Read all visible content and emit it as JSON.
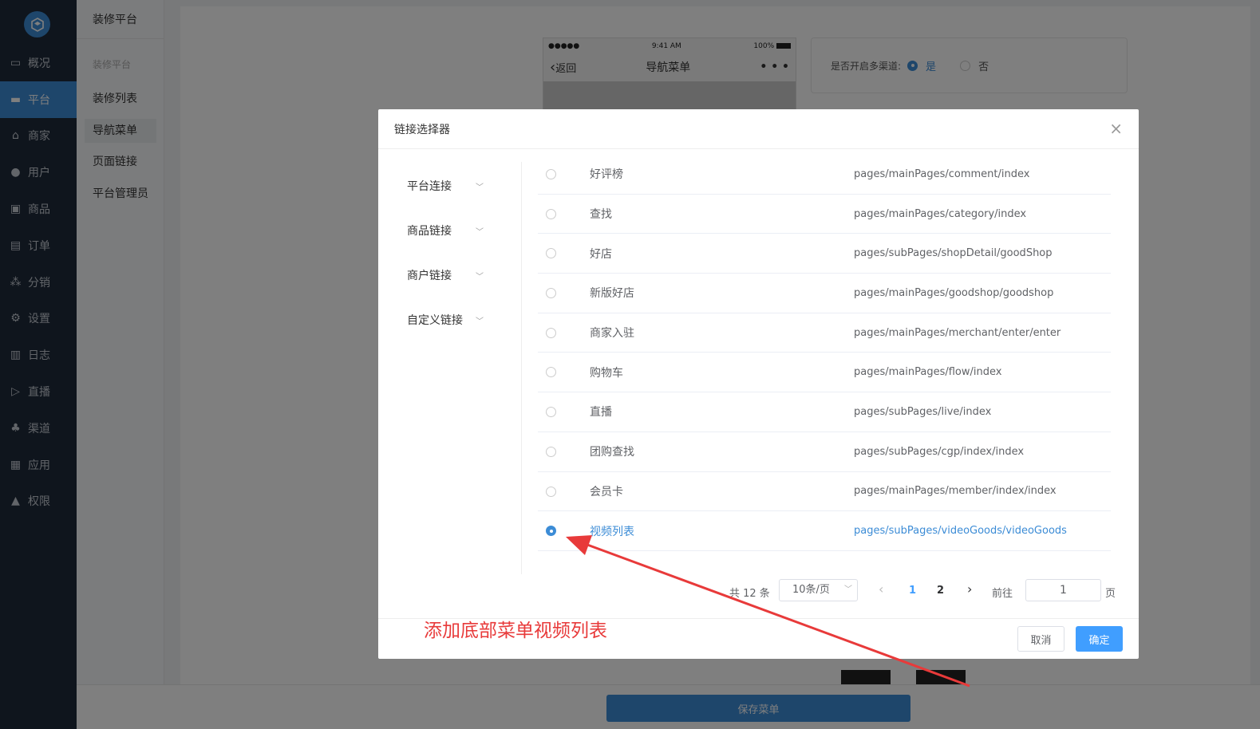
{
  "sidebar": {
    "items": [
      {
        "label": "概况",
        "icon": "monitor-icon"
      },
      {
        "label": "平台",
        "icon": "screen-icon",
        "active": true
      },
      {
        "label": "商家",
        "icon": "store-icon"
      },
      {
        "label": "用户",
        "icon": "user-icon"
      },
      {
        "label": "商品",
        "icon": "box-icon"
      },
      {
        "label": "订单",
        "icon": "order-icon"
      },
      {
        "label": "分销",
        "icon": "tree-icon"
      },
      {
        "label": "设置",
        "icon": "gear-icon"
      },
      {
        "label": "日志",
        "icon": "book-icon"
      },
      {
        "label": "直播",
        "icon": "live-icon"
      },
      {
        "label": "渠道",
        "icon": "channel-icon"
      },
      {
        "label": "应用",
        "icon": "grid-icon"
      },
      {
        "label": "权限",
        "icon": "lock-icon"
      }
    ]
  },
  "subnav": {
    "title": "装修平台",
    "group": "装修平台",
    "items": [
      "装修列表",
      "导航菜单",
      "页面链接",
      "平台管理员"
    ]
  },
  "phone": {
    "time": "9:41 AM",
    "battery": "100%",
    "signal": "●●●●●",
    "back": "返回",
    "title": "导航菜单",
    "more": "• • •"
  },
  "channel": {
    "label": "是否开启多渠道:",
    "yes": "是",
    "no": "否"
  },
  "save_button": "保存菜单",
  "dialog": {
    "title": "链接选择器",
    "close": "×",
    "categories": [
      "平台连接",
      "商品链接",
      "商户链接",
      "自定义链接"
    ],
    "rows": [
      {
        "name": "好评榜",
        "path": "pages/mainPages/comment/index",
        "selected": false
      },
      {
        "name": "查找",
        "path": "pages/mainPages/category/index",
        "selected": false
      },
      {
        "name": "好店",
        "path": "pages/subPages/shopDetail/goodShop",
        "selected": false
      },
      {
        "name": "新版好店",
        "path": "pages/mainPages/goodshop/goodshop",
        "selected": false
      },
      {
        "name": "商家入驻",
        "path": "pages/mainPages/merchant/enter/enter",
        "selected": false
      },
      {
        "name": "购物车",
        "path": "pages/mainPages/flow/index",
        "selected": false
      },
      {
        "name": "直播",
        "path": "pages/subPages/live/index",
        "selected": false
      },
      {
        "name": "团购查找",
        "path": "pages/subPages/cgp/index/index",
        "selected": false
      },
      {
        "name": "会员卡",
        "path": "pages/mainPages/member/index/index",
        "selected": false
      },
      {
        "name": "视频列表",
        "path": "pages/subPages/videoGoods/videoGoods",
        "selected": true
      }
    ],
    "pager": {
      "total": "共 12 条",
      "size": "10条/页",
      "prev": "‹",
      "pages": [
        "1",
        "2"
      ],
      "current": "1",
      "next": "›",
      "goto": "前往",
      "goto_value": "1",
      "page_suffix": "页"
    },
    "cancel": "取消",
    "ok": "确定"
  },
  "annotation": "添加底部菜单视频列表",
  "colors": {
    "accent": "#3c8cd6",
    "primary_button": "#409eff",
    "annotation": "#e83a3a",
    "sidebar": "#1f2a3a"
  }
}
